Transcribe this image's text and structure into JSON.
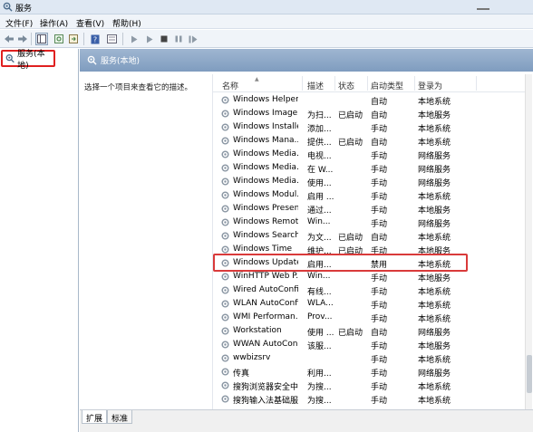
{
  "window": {
    "title": "服务"
  },
  "menu": [
    {
      "label": "文件(F)"
    },
    {
      "label": "操作(A)"
    },
    {
      "label": "查看(V)"
    },
    {
      "label": "帮助(H)"
    }
  ],
  "tree": {
    "root_label": "服务(本地)"
  },
  "pane": {
    "header_label": "服务(本地)",
    "description": "选择一个项目来查看它的描述。"
  },
  "list": {
    "columns": [
      "名称",
      "描述",
      "状态",
      "启动类型",
      "登录为"
    ],
    "rows": [
      {
        "name": "Windows Helper...",
        "desc": "",
        "status": "",
        "startup": "自动",
        "logon": "本地系统"
      },
      {
        "name": "Windows Image...",
        "desc": "为扫...",
        "status": "已启动",
        "startup": "自动",
        "logon": "本地服务"
      },
      {
        "name": "Windows Installer",
        "desc": "添加...",
        "status": "",
        "startup": "手动",
        "logon": "本地系统"
      },
      {
        "name": "Windows Mana...",
        "desc": "提供...",
        "status": "已启动",
        "startup": "自动",
        "logon": "本地系统"
      },
      {
        "name": "Windows Media...",
        "desc": "电视...",
        "status": "",
        "startup": "手动",
        "logon": "网络服务"
      },
      {
        "name": "Windows Media...",
        "desc": "在 W...",
        "status": "",
        "startup": "手动",
        "logon": "网络服务"
      },
      {
        "name": "Windows Media...",
        "desc": "使用...",
        "status": "",
        "startup": "手动",
        "logon": "网络服务"
      },
      {
        "name": "Windows Modul...",
        "desc": "启用 ...",
        "status": "",
        "startup": "手动",
        "logon": "本地系统"
      },
      {
        "name": "Windows Presen...",
        "desc": "通过...",
        "status": "",
        "startup": "手动",
        "logon": "本地服务"
      },
      {
        "name": "Windows Remot...",
        "desc": "Win...",
        "status": "",
        "startup": "手动",
        "logon": "网络服务"
      },
      {
        "name": "Windows Search",
        "desc": "为文...",
        "status": "已启动",
        "startup": "自动",
        "logon": "本地系统"
      },
      {
        "name": "Windows Time",
        "desc": "维护...",
        "status": "已启动",
        "startup": "手动",
        "logon": "本地服务"
      },
      {
        "name": "Windows Update",
        "desc": "启用...",
        "status": "",
        "startup": "禁用",
        "logon": "本地系统",
        "highlighted": true
      },
      {
        "name": "WinHTTP Web P...",
        "desc": "Win...",
        "status": "",
        "startup": "手动",
        "logon": "本地服务"
      },
      {
        "name": "Wired AutoConfig",
        "desc": "有线...",
        "status": "",
        "startup": "手动",
        "logon": "本地系统"
      },
      {
        "name": "WLAN AutoConfig",
        "desc": "WLA...",
        "status": "",
        "startup": "手动",
        "logon": "本地系统"
      },
      {
        "name": "WMI Performan...",
        "desc": "Prov...",
        "status": "",
        "startup": "手动",
        "logon": "本地系统"
      },
      {
        "name": "Workstation",
        "desc": "使用 ...",
        "status": "已启动",
        "startup": "自动",
        "logon": "网络服务"
      },
      {
        "name": "WWAN AutoCon...",
        "desc": "该服...",
        "status": "",
        "startup": "手动",
        "logon": "本地服务"
      },
      {
        "name": "wwbizsrv",
        "desc": "",
        "status": "",
        "startup": "手动",
        "logon": "本地系统"
      },
      {
        "name": "传真",
        "desc": "利用...",
        "status": "",
        "startup": "手动",
        "logon": "网络服务"
      },
      {
        "name": "搜狗浏览器安全中...",
        "desc": "为搜...",
        "status": "",
        "startup": "手动",
        "logon": "本地系统"
      },
      {
        "name": "搜狗输入法基础服...",
        "desc": "为搜...",
        "status": "",
        "startup": "手动",
        "logon": "本地系统"
      }
    ]
  },
  "tabs": [
    {
      "label": "扩展"
    },
    {
      "label": "标准"
    }
  ],
  "colors": {
    "header_blue": "#8fa9c9",
    "highlight_red": "#d93a3a"
  }
}
